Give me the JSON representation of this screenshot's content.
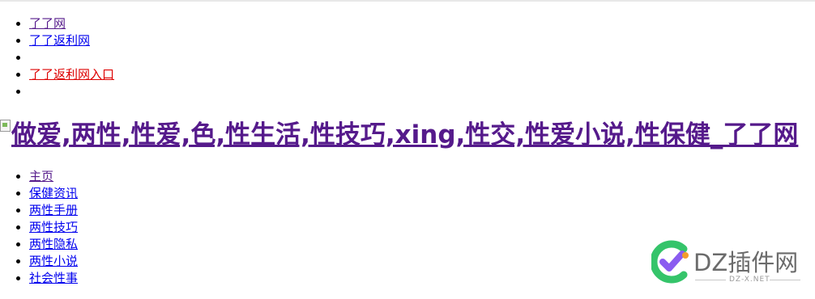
{
  "top_nav": {
    "items": [
      {
        "label": "了了网"
      },
      {
        "label": "了了返利网"
      },
      {
        "label": ""
      },
      {
        "label": "了了返利网入口"
      },
      {
        "label": ""
      }
    ]
  },
  "heading": {
    "title": "做爱,两性,性爱,色,性生活,性技巧,xing,性交,性爱小说,性保健_了了网"
  },
  "main_nav": {
    "items": [
      {
        "label": "主页"
      },
      {
        "label": "保健资讯"
      },
      {
        "label": "两性手册"
      },
      {
        "label": "两性技巧"
      },
      {
        "label": "两性隐私"
      },
      {
        "label": "两性小说"
      },
      {
        "label": "社会性事"
      }
    ]
  },
  "watermark": {
    "brand": "DZ插件网",
    "domain": "DZ-X.NET"
  },
  "colors": {
    "visited_link": "#551a8b",
    "link": "#0000ee",
    "highlight_link": "#dd0000"
  }
}
